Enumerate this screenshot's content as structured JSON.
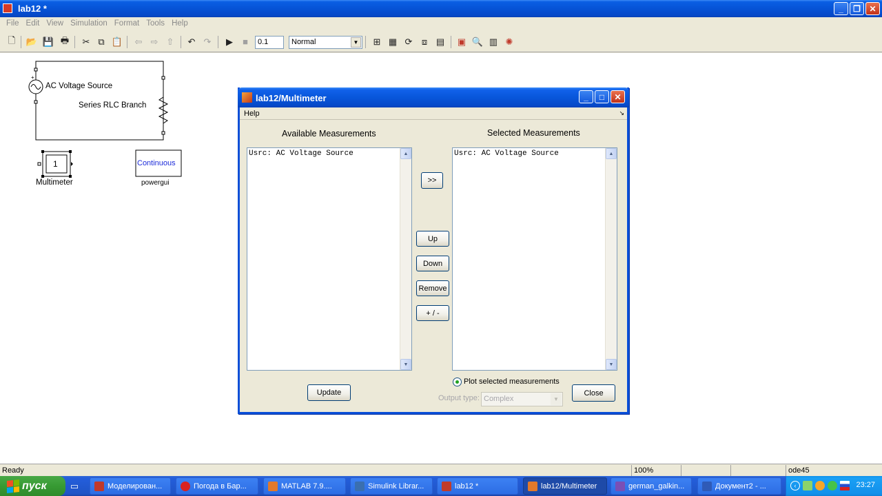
{
  "window": {
    "title": "lab12 *"
  },
  "menubar": [
    "File",
    "Edit",
    "View",
    "Simulation",
    "Format",
    "Tools",
    "Help"
  ],
  "toolbar": {
    "stop_time": "0.1",
    "sim_mode": "Normal"
  },
  "canvas": {
    "ac_source_label": "AC Voltage Source",
    "rlc_label": "Series RLC Branch",
    "multimeter_value": "1",
    "multimeter_label": "Multimeter",
    "powergui_text": "Continuous",
    "powergui_label": "powergui"
  },
  "dialog": {
    "title": "lab12/Multimeter",
    "menu_help": "Help",
    "available_header": "Available Measurements",
    "selected_header": "Selected Measurements",
    "available_items": [
      "Usrc: AC Voltage Source"
    ],
    "selected_items": [
      "Usrc: AC Voltage Source"
    ],
    "add_button": ">>",
    "up_button": "Up",
    "down_button": "Down",
    "remove_button": "Remove",
    "sign_button": "+ / -",
    "update_button": "Update",
    "plot_label": "Plot selected measurements",
    "output_type_label": "Output type:",
    "output_type_value": "Complex",
    "close_button": "Close"
  },
  "statusbar": {
    "status": "Ready",
    "zoom": "100%",
    "solver": "ode45"
  },
  "taskbar": {
    "start": "пуск",
    "items": [
      {
        "label": "Моделирован...",
        "icon_color": "#c0392b"
      },
      {
        "label": "Погода в Бар...",
        "icon_color": "#d92222"
      },
      {
        "label": "MATLAB 7.9....",
        "icon_color": "#e2792b"
      },
      {
        "label": "Simulink Librar...",
        "icon_color": "#3a6fb0"
      },
      {
        "label": "lab12 *",
        "icon_color": "#c13b2a"
      },
      {
        "label": "lab12/Multimeter",
        "icon_color": "#e2792b"
      },
      {
        "label": "german_galkin...",
        "icon_color": "#7a4fb5"
      },
      {
        "label": "Документ2 - ...",
        "icon_color": "#2f5bb7"
      }
    ],
    "clock": "23:27"
  }
}
